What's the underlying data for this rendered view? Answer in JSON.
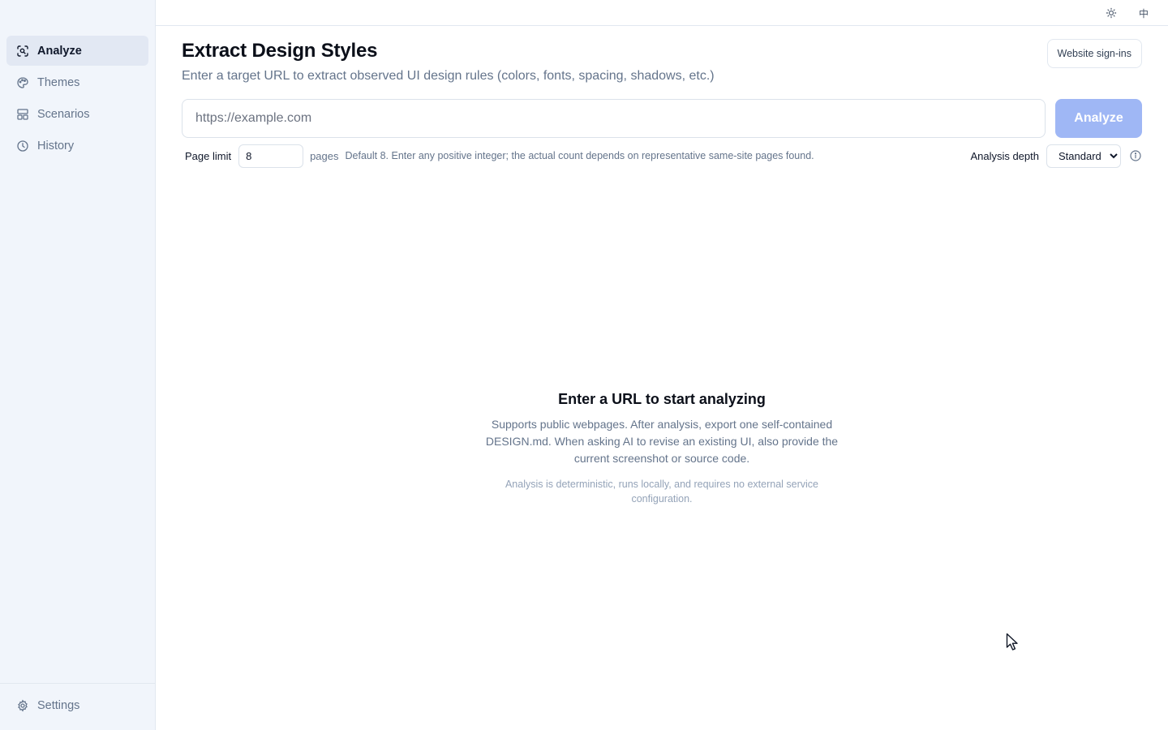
{
  "sidebar": {
    "items": [
      {
        "label": "Analyze",
        "icon": "scan-icon",
        "active": true
      },
      {
        "label": "Themes",
        "icon": "palette-icon",
        "active": false
      },
      {
        "label": "Scenarios",
        "icon": "layout-icon",
        "active": false
      },
      {
        "label": "History",
        "icon": "clock-icon",
        "active": false
      }
    ],
    "settings_label": "Settings"
  },
  "topbar": {
    "theme_toggle_icon": "sun-icon",
    "language_label": "中"
  },
  "header": {
    "title": "Extract Design Styles",
    "subtitle": "Enter a target URL to extract observed UI design rules (colors, fonts, spacing, shadows, etc.)",
    "signins_label": "Website sign-ins"
  },
  "url_form": {
    "placeholder": "https://example.com",
    "value": "",
    "analyze_label": "Analyze"
  },
  "options": {
    "page_limit_label": "Page limit",
    "page_limit_value": "8",
    "pages_unit": "pages",
    "hint": "Default 8. Enter any positive integer; the actual count depends on representative same-site pages found.",
    "depth_label": "Analysis depth",
    "depth_selected": "Standard"
  },
  "empty_state": {
    "title": "Enter a URL to start analyzing",
    "description": "Supports public webpages. After analysis, export one self-contained DESIGN.md. When asking AI to revise an existing UI, also provide the current screenshot or source code.",
    "note": "Analysis is deterministic, runs locally, and requires no external service configuration."
  },
  "colors": {
    "sidebar_bg": "#f1f5fb",
    "active_item_bg": "#e2e8f3",
    "primary_disabled": "#9fb7f5",
    "muted_text": "#64748b"
  }
}
